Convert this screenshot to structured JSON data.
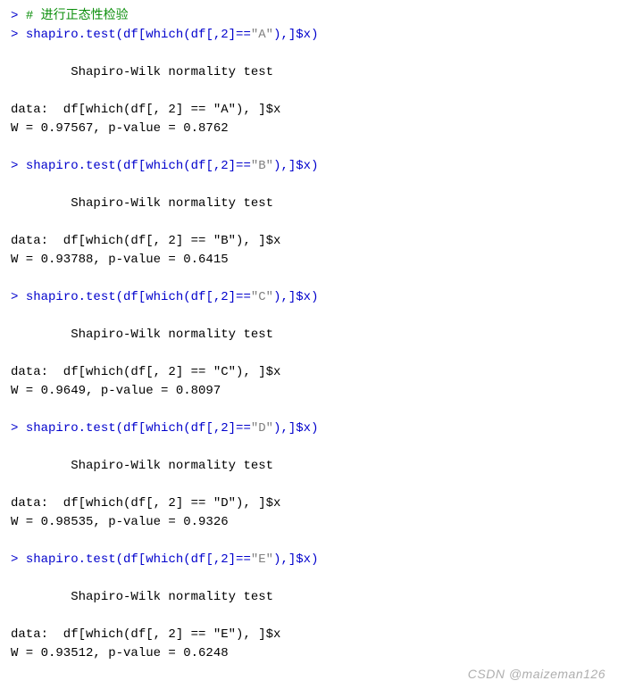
{
  "prompt_symbol": "> ",
  "comment_line": "# 进行正态性检验",
  "blocks": [
    {
      "cmd_pre": "shapiro.test(df[which(df[,2]==",
      "cmd_str": "\"A\"",
      "cmd_post": "),]$x)",
      "out_header": "        Shapiro-Wilk normality test",
      "out_data": "data:  df[which(df[, 2] == \"A\"), ]$x",
      "out_stats": "W = 0.97567, p-value = 0.8762"
    },
    {
      "cmd_pre": "shapiro.test(df[which(df[,2]==",
      "cmd_str": "\"B\"",
      "cmd_post": "),]$x)",
      "out_header": "        Shapiro-Wilk normality test",
      "out_data": "data:  df[which(df[, 2] == \"B\"), ]$x",
      "out_stats": "W = 0.93788, p-value = 0.6415"
    },
    {
      "cmd_pre": "shapiro.test(df[which(df[,2]==",
      "cmd_str": "\"C\"",
      "cmd_post": "),]$x)",
      "out_header": "        Shapiro-Wilk normality test",
      "out_data": "data:  df[which(df[, 2] == \"C\"), ]$x",
      "out_stats": "W = 0.9649, p-value = 0.8097"
    },
    {
      "cmd_pre": "shapiro.test(df[which(df[,2]==",
      "cmd_str": "\"D\"",
      "cmd_post": "),]$x)",
      "out_header": "        Shapiro-Wilk normality test",
      "out_data": "data:  df[which(df[, 2] == \"D\"), ]$x",
      "out_stats": "W = 0.98535, p-value = 0.9326"
    },
    {
      "cmd_pre": "shapiro.test(df[which(df[,2]==",
      "cmd_str": "\"E\"",
      "cmd_post": "),]$x)",
      "out_header": "        Shapiro-Wilk normality test",
      "out_data": "data:  df[which(df[, 2] == \"E\"), ]$x",
      "out_stats": "W = 0.93512, p-value = 0.6248"
    }
  ],
  "watermark": "CSDN @maizeman126"
}
